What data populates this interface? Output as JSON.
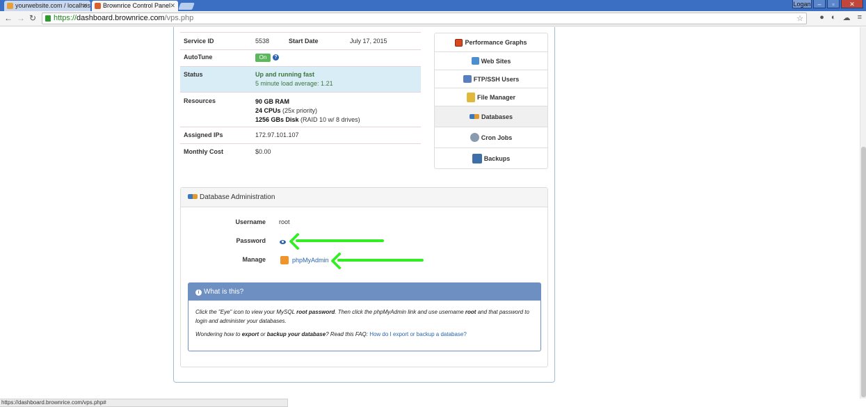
{
  "browser": {
    "tabs": [
      {
        "title": "yourwebsite.com / localhost",
        "active": false
      },
      {
        "title": "Brownrice Control Panel",
        "active": true
      }
    ],
    "user_label": "Logan",
    "url": {
      "scheme": "https://",
      "host": "dashboard.brownrice.com",
      "path": "/vps.php"
    },
    "status_url": "https://dashboard.brownrice.com/vps.php#"
  },
  "service": {
    "service_id_label": "Service ID",
    "service_id": "5538",
    "start_date_label": "Start Date",
    "start_date": "July 17, 2015",
    "autotune_label": "AutoTune",
    "autotune_toggle": "On",
    "status_label": "Status",
    "status_title": "Up and running fast",
    "status_sub": "5 minute load average: 1.21",
    "resources_label": "Resources",
    "ram_bold": "90 GB RAM",
    "cpus_bold": "24 CPUs",
    "cpus_note": " (25x priority)",
    "disk_bold": "1256 GBs Disk",
    "disk_note": " (RAID 10 w/ 8 drives)",
    "ips_label": "Assigned IPs",
    "ips": "172.97.101.107",
    "cost_label": "Monthly Cost",
    "cost": "$0.00"
  },
  "sidebar": {
    "items": [
      {
        "label": "Performance Graphs",
        "icon": "performance-graph-icon"
      },
      {
        "label": "Web Sites",
        "icon": "web-sites-icon"
      },
      {
        "label": "FTP/SSH Users",
        "icon": "users-icon"
      },
      {
        "label": "File Manager",
        "icon": "file-manager-icon"
      },
      {
        "label": "Databases",
        "icon": "database-icon",
        "active": true
      },
      {
        "label": "Cron Jobs",
        "icon": "cron-icon"
      },
      {
        "label": "Backups",
        "icon": "backup-icon"
      }
    ]
  },
  "db_admin": {
    "title": "Database Administration",
    "username_label": "Username",
    "username": "root",
    "password_label": "Password",
    "manage_label": "Manage",
    "manage_link": "phpMyAdmin"
  },
  "what_is_this": {
    "title": "What is this?",
    "p1_a": "Click the \"Eye\" icon to view your MySQL ",
    "p1_b": "root password",
    "p1_c": ". Then click the phpMyAdmin link and use username ",
    "p1_d": "root",
    "p1_e": " and that password to login and administer your databases.",
    "p2_a": "Wondering how to ",
    "p2_b": "export",
    "p2_c": " or ",
    "p2_d": "backup your database",
    "p2_e": "? Read this FAQ: ",
    "p2_link": "How do I export or backup a database?"
  },
  "colors": {
    "accent_blue": "#2a64b0",
    "status_green": "#3c763d",
    "annotation_arrow": "#33ee22"
  }
}
